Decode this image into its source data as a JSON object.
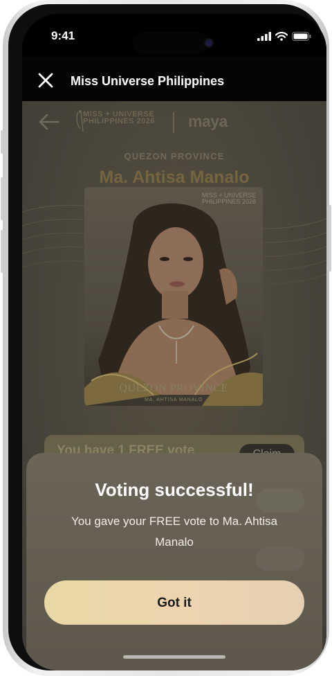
{
  "status_bar": {
    "time": "9:41"
  },
  "header": {
    "title": "Miss Universe Philippines",
    "close_icon": "close-icon"
  },
  "logo": {
    "line1": "MISS + UNIVERSE",
    "line2": "PHILIPPINES 2026",
    "partner": "maya"
  },
  "contestant": {
    "province": "QUEZON PROVINCE",
    "name": "Ma. Ahtisa Manalo",
    "portrait_logo_line1": "MISS + UNIVERSE",
    "portrait_logo_line2": "PHILIPPINES 2026",
    "portrait_province": "QUEZON PROVINCE",
    "portrait_name": "MA. AHTISA MANALO"
  },
  "vote_banner": {
    "text": "You have 1 FREE vote",
    "claim_label": "Claim"
  },
  "modal": {
    "title": "Voting successful!",
    "message": "You gave your FREE vote to Ma. Ahtisa Manalo",
    "button_label": "Got it"
  },
  "colors": {
    "accent_gold": "#E9D8A6",
    "background": "#47443A",
    "header_bg": "#050505"
  }
}
